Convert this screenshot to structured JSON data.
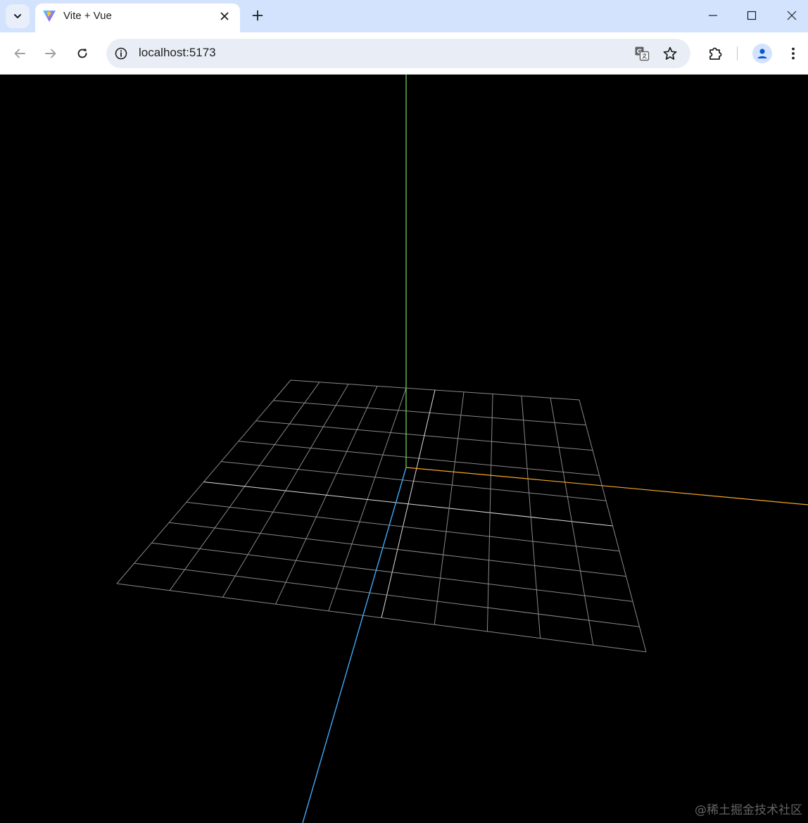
{
  "browser": {
    "tab": {
      "title": "Vite + Vue"
    },
    "address_bar": {
      "url": "localhost:5173"
    },
    "icons": {
      "tab_search": "chevron-down-icon",
      "favicon": "vite-logo-icon",
      "tab_close": "close-icon",
      "new_tab": "plus-icon",
      "minimize": "minimize-icon",
      "maximize": "maximize-icon",
      "window_close": "close-icon",
      "back": "arrow-left-icon",
      "forward": "arrow-right-icon",
      "reload": "reload-icon",
      "site_info": "info-icon",
      "translate": "translate-icon",
      "bookmark": "star-icon",
      "extensions": "puzzle-icon",
      "profile": "person-icon",
      "menu": "kebab-menu-icon"
    }
  },
  "scene": {
    "background": "#000000",
    "grid": {
      "divisions": 10,
      "line_color": "#888888",
      "center_color": "#dddddd"
    },
    "axes": {
      "x_color": "#f5a623",
      "y_color": "#7ed957",
      "z_color": "#3fa9f5"
    }
  },
  "watermark": {
    "text": "@稀土掘金技术社区"
  }
}
